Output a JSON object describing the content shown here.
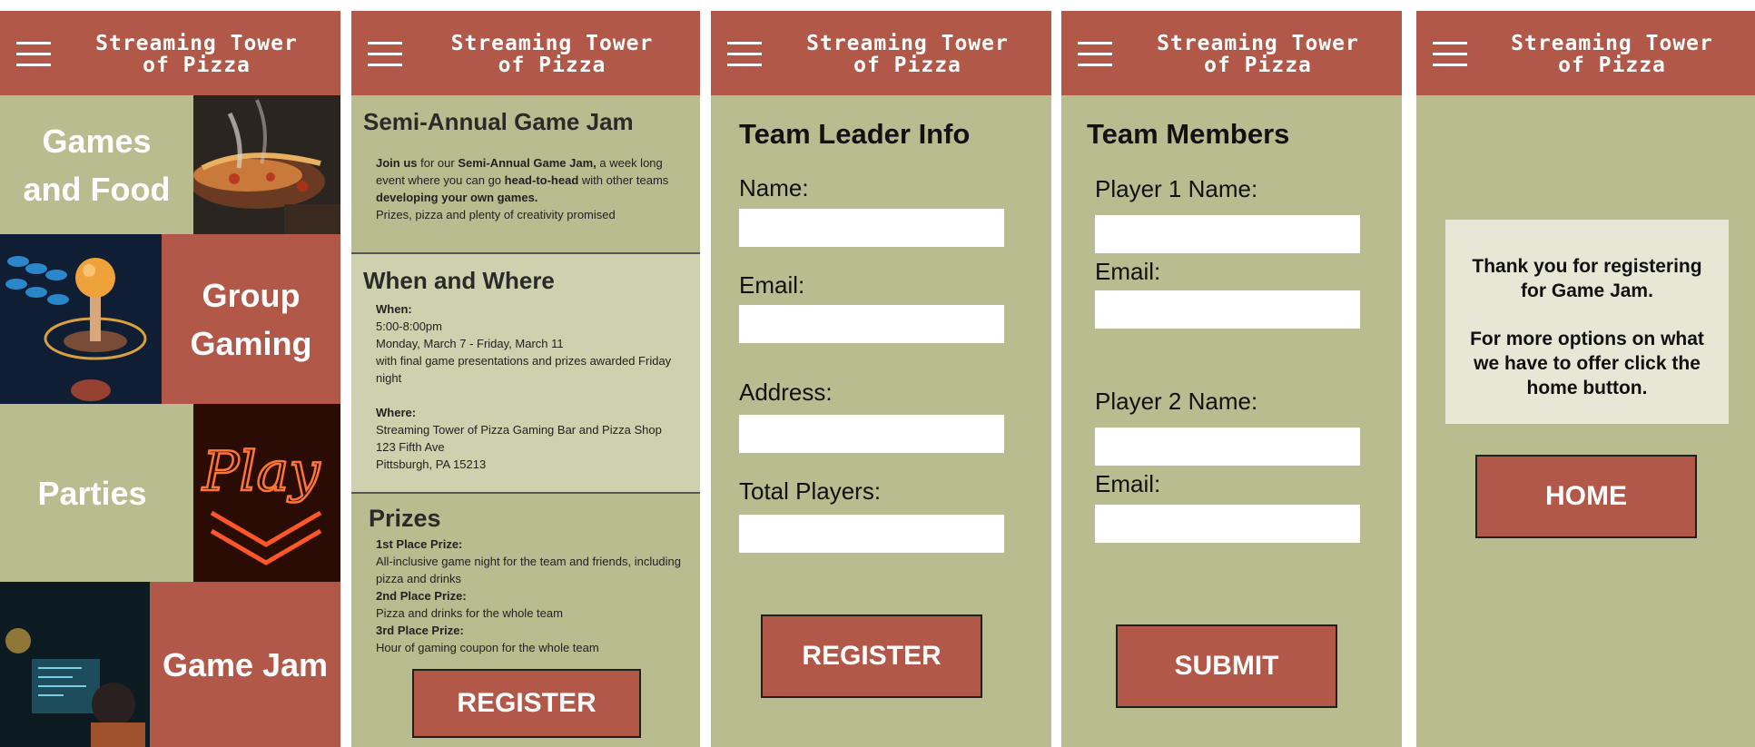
{
  "brand": {
    "line1": "Streaming Tower",
    "line2": "of Pizza"
  },
  "screen1": {
    "tiles": [
      {
        "line1": "Games",
        "line2": "and Food"
      },
      {
        "line1": "Group",
        "line2": "Gaming"
      },
      {
        "line1": "Parties"
      },
      {
        "line1": "Game Jam"
      }
    ]
  },
  "screen2": {
    "jam": {
      "title": "Semi-Annual Game Jam",
      "t1": "Join us",
      "t2": " for our ",
      "t3": "Semi-Annual Game Jam,",
      "t4": " a week long event where you can go ",
      "t5": "head-to-head",
      "t6": " with other teams ",
      "t7": "developing your own games.",
      "t8": "Prizes, pizza and plenty of creativity promised"
    },
    "when": {
      "title": "When and Where",
      "when_label": "When:",
      "time": "5:00-8:00pm",
      "dates": "Monday, March 7 - Friday, March 11",
      "note": "with final game presentations and prizes awarded Friday night",
      "where_label": "Where:",
      "venue": "Streaming Tower of Pizza Gaming Bar and Pizza Shop",
      "street": "123 Fifth Ave",
      "city": "Pittsburgh, PA 15213"
    },
    "prizes": {
      "title": "Prizes",
      "p1_label": "1st Place Prize:",
      "p1": "All-inclusive game night for the team and friends, including pizza and drinks",
      "p2_label": "2nd Place Prize:",
      "p2": "Pizza and drinks for the whole team",
      "p3_label": "3rd Place Prize:",
      "p3": "Hour of gaming coupon for the whole team"
    },
    "register": "REGISTER"
  },
  "screen3": {
    "title": "Team Leader Info",
    "name": "Name:",
    "email": "Email:",
    "address": "Address:",
    "players": "Total Players:",
    "register": "REGISTER"
  },
  "screen4": {
    "title": "Team Members",
    "p1_name": "Player 1 Name:",
    "p1_email": "Email:",
    "p2_name": "Player 2 Name:",
    "p2_email": "Email:",
    "submit": "SUBMIT"
  },
  "screen5": {
    "msg1": "Thank you for registering for Game Jam.",
    "msg2": "For more options on what we have to offer click the home button.",
    "home": "HOME"
  },
  "colors": {
    "accent": "#b15848",
    "panel": "#b9bc8e",
    "light_panel": "#cdd1ad",
    "card": "#e6e8d5"
  }
}
